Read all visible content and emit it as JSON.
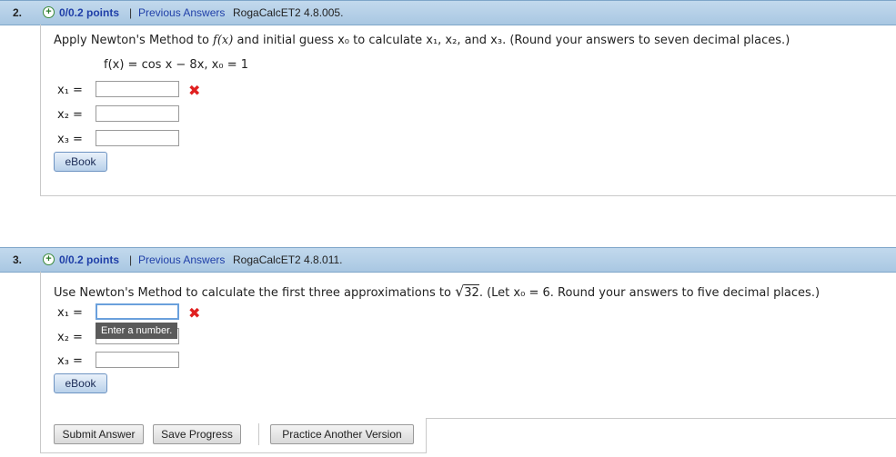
{
  "q2": {
    "number": "2.",
    "points": "0/0.2 points",
    "separator": "|",
    "previous_answers": "Previous Answers",
    "source": "RogaCalcET2 4.8.005.",
    "prompt_pre": "Apply Newton's Method to ",
    "prompt_fx": "f(x)",
    "prompt_mid": " and initial guess ",
    "prompt_rest": " to calculate x₁, x₂, and x₃.  (Round your answers to seven decimal places.)",
    "function_line": "f(x) = cos x − 8x,   x₀ = 1",
    "x0_label": "x₀",
    "labels": [
      "x₁ =",
      "x₂ =",
      "x₃ ="
    ],
    "values": [
      "",
      "",
      ""
    ],
    "ebook": "eBook"
  },
  "q3": {
    "number": "3.",
    "points": "0/0.2 points",
    "separator": "|",
    "previous_answers": "Previous Answers",
    "source": "RogaCalcET2 4.8.011.",
    "prompt_pre": "Use Newton's Method to calculate the first three approximations to ",
    "radicand": "32",
    "prompt_rest": ".  (Let x₀ = 6.  Round your answers to five decimal places.)",
    "labels": [
      "x₁ =",
      "x₂ =",
      "x₃ ="
    ],
    "values": [
      "",
      "",
      ""
    ],
    "tooltip": "Enter a number.",
    "ebook": "eBook"
  },
  "actions": {
    "submit": "Submit Answer",
    "save": "Save Progress",
    "practice": "Practice Another Version"
  }
}
